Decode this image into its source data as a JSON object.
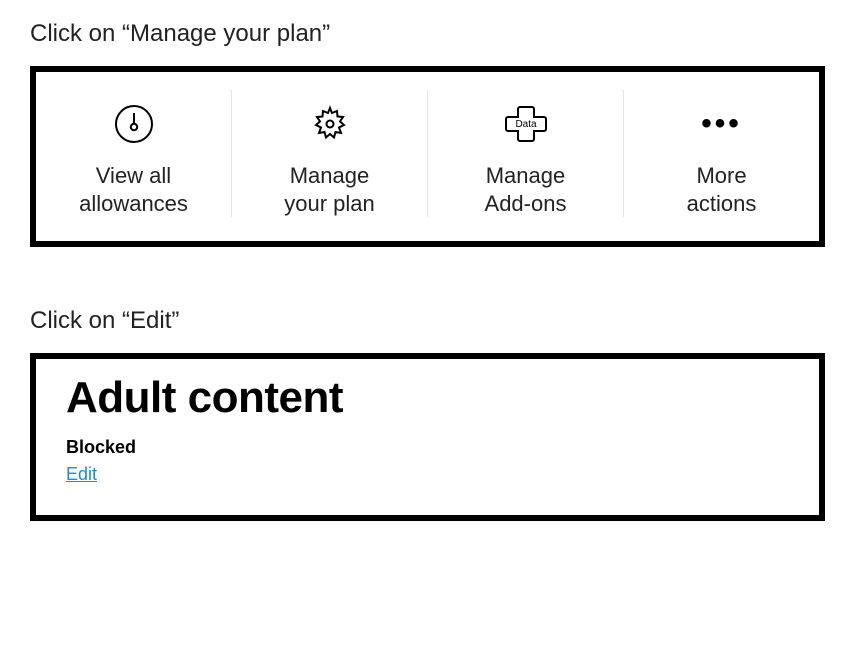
{
  "instructions": {
    "step1": "Click on “Manage your plan”",
    "step2": "Click on “Edit”"
  },
  "actions": {
    "item1": {
      "label_line1": "View all",
      "label_line2": "allowances"
    },
    "item2": {
      "label_line1": "Manage",
      "label_line2": "your plan"
    },
    "item3": {
      "label_line1": "Manage",
      "label_line2": "Add-ons",
      "icon_text": "Data"
    },
    "item4": {
      "label_line1": "More",
      "label_line2": "actions"
    }
  },
  "adult_content": {
    "title": "Adult content",
    "status": "Blocked",
    "edit_label": "Edit"
  }
}
